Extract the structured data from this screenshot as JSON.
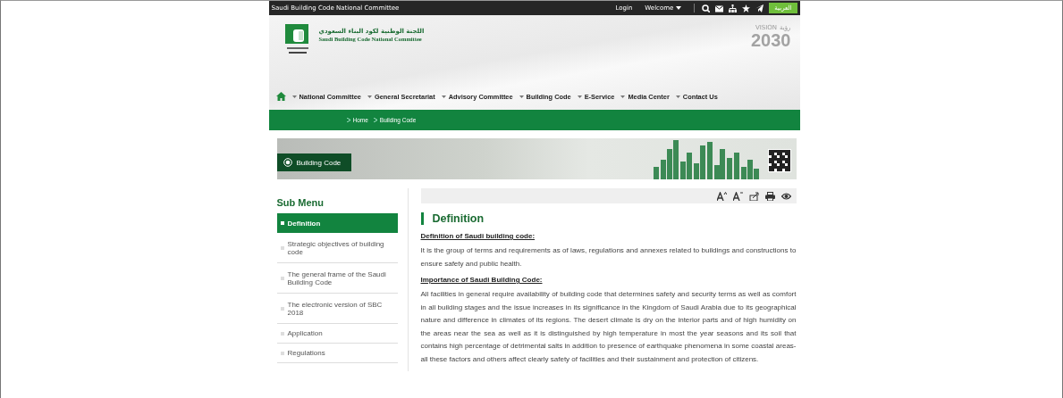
{
  "top_bar": {
    "site_name": "Saudi Building Code National Committee",
    "login": "Login",
    "welcome": "Welcome",
    "language_button": "العربية"
  },
  "header": {
    "logo_arabic": "اللجنة الوطنية لكود البناء السعودي",
    "logo_english": "Saudi Building Code National Committee",
    "vision_latin": "VISION",
    "vision_arabic": "رؤية",
    "vision_year": "2030"
  },
  "nav": [
    "National Committee",
    "General Secretariat",
    "Advisory Committee",
    "Building Code",
    "E-Service",
    "Media Center",
    "Contact Us"
  ],
  "breadcrumb": [
    "Home",
    "Building Code"
  ],
  "banner": {
    "title": "Building Code"
  },
  "sidebar": {
    "title": "Sub Menu",
    "items": [
      {
        "label": "Definition",
        "selected": true
      },
      {
        "label": "Strategic objectives of building code",
        "selected": false
      },
      {
        "label": "The general frame of the Saudi Building Code",
        "selected": false
      },
      {
        "label": "The electronic version of SBC 2018",
        "selected": false
      },
      {
        "label": "Application",
        "selected": false
      },
      {
        "label": "Regulations",
        "selected": false
      }
    ]
  },
  "article": {
    "title": "Definition",
    "sections": [
      {
        "heading": "Definition of Saudi building code:",
        "text": "It is the group of terms and requirements as of laws, regulations and annexes related to buildings and constructions to ensure safety and public health."
      },
      {
        "heading": "Importance of Saudi Building Code:",
        "text": "All facilities in general require availability of building code that determines safety and security terms as well as comfort in all building stages and the issue increases in its significance in the Kingdom of Saudi Arabia due to its geographical nature and difference in climates of its regions. The desert climate is dry on the interior parts and of high humidity on the areas near the sea as well as it is distinguished by high temperature in most the year seasons and its soil that contains high percentage of detrimental salts in addition to presence of earthquake phenomena in some coastal areas- all these factors and others affect clearly safety of facilities and their sustainment and protection of citizens."
      }
    ]
  }
}
